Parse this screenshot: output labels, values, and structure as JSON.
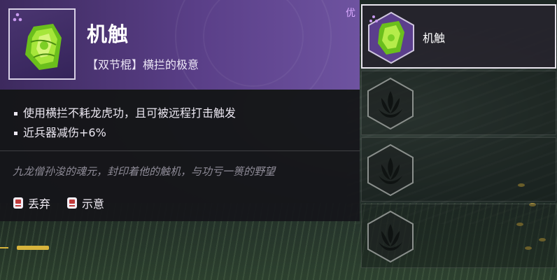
{
  "item": {
    "name": "机触",
    "subtitle": "【双节棍】横拦的极意",
    "quality_badge": "优",
    "rarity_color": "#b98be0",
    "effects": [
      "使用横拦不耗龙虎功，且可被远程打击触发",
      "近兵器减伤+6%"
    ],
    "lore": "九龙僧孙浚的魂元，封印着他的触机，与功亏一篑的野望"
  },
  "actions": [
    {
      "label": "丢弃",
      "icon": "keycap-icon"
    },
    {
      "label": "示意",
      "icon": "keycap-icon"
    }
  ],
  "slots": [
    {
      "name": "机触",
      "state": "filled",
      "icon": "relic-icon"
    },
    {
      "name": "",
      "state": "empty",
      "icon": "lotus-emblem-icon"
    },
    {
      "name": "",
      "state": "empty",
      "icon": "lotus-emblem-icon"
    },
    {
      "name": "",
      "state": "empty",
      "icon": "lotus-emblem-icon"
    }
  ],
  "colors": {
    "header_purple": "#5a3f88",
    "body_dark": "#16161a",
    "item_green": "#8fd12a"
  }
}
